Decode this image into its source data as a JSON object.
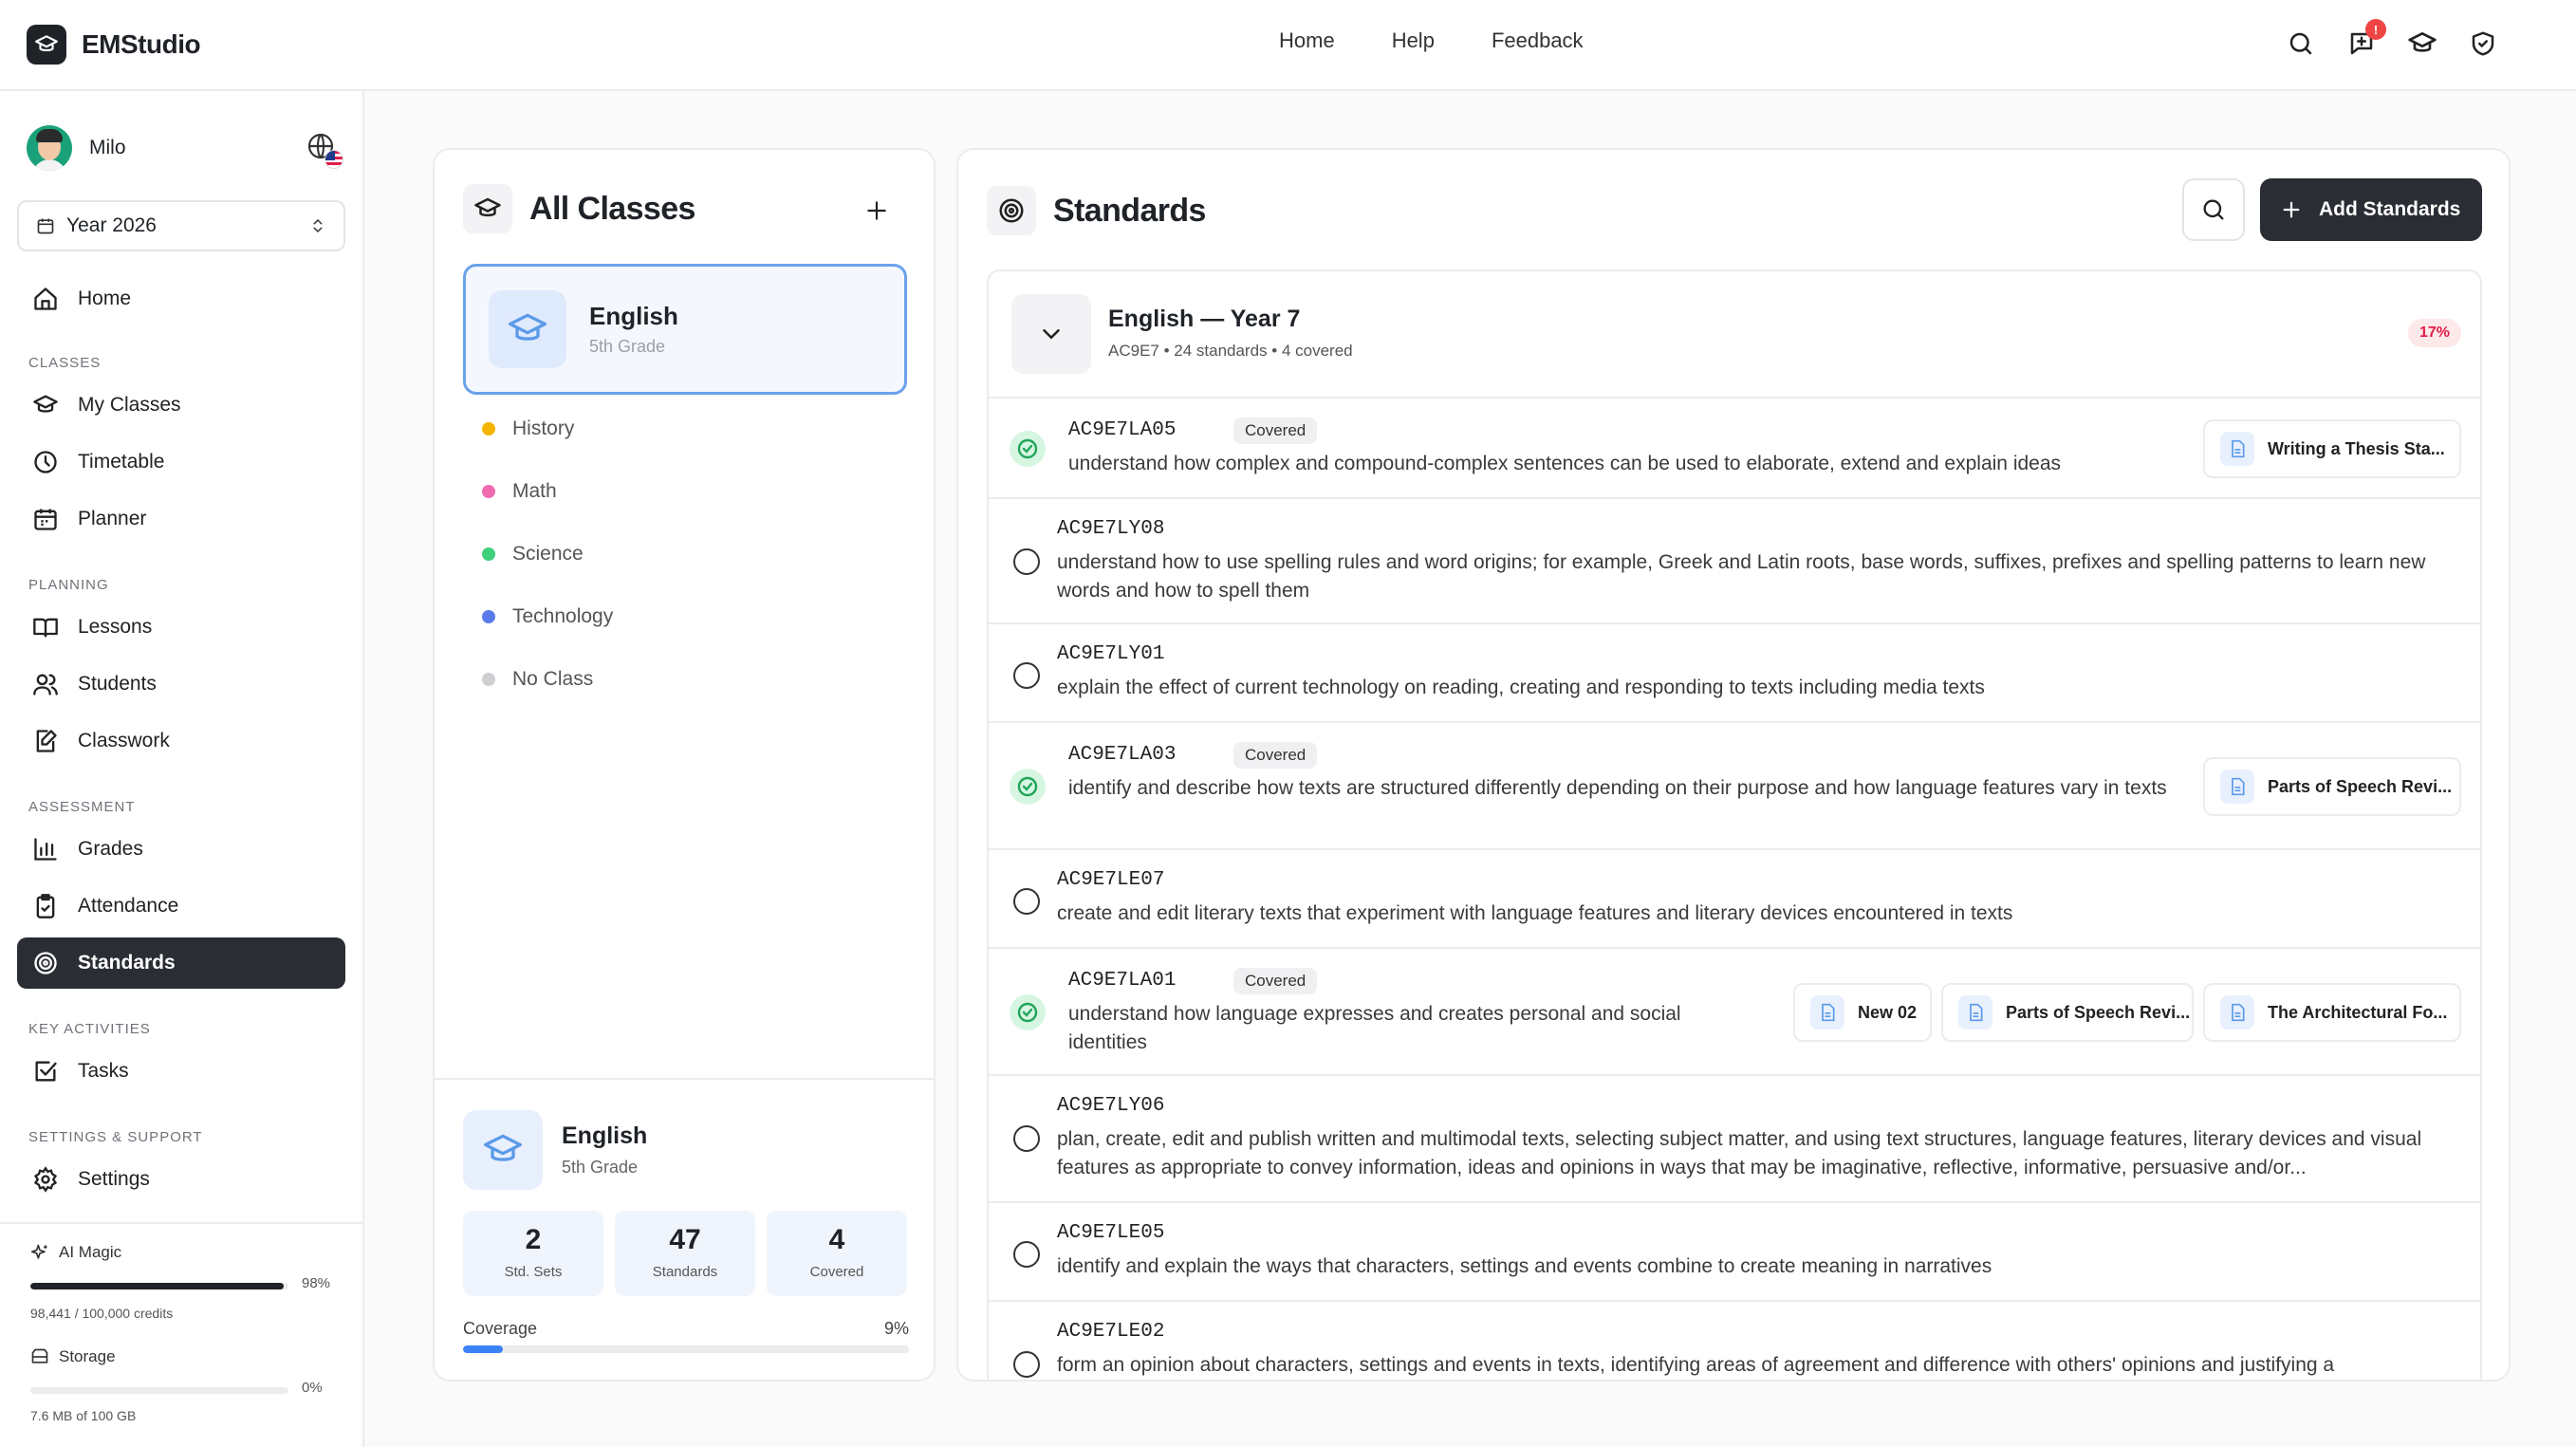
{
  "app": {
    "name": "EMStudio"
  },
  "topnav": {
    "items": [
      "Home",
      "Help",
      "Feedback"
    ],
    "notifications_count": "!"
  },
  "user": {
    "name": "Milo"
  },
  "year_select": {
    "value": "Year 2026"
  },
  "sidebar": {
    "home": "Home",
    "sections": {
      "classes": "CLASSES",
      "planning": "PLANNING",
      "assessment": "ASSESSMENT",
      "key_activities": "KEY ACTIVITIES",
      "settings_support": "SETTINGS & SUPPORT"
    },
    "items": {
      "my_classes": "My Classes",
      "timetable": "Timetable",
      "planner": "Planner",
      "lessons": "Lessons",
      "students": "Students",
      "classwork": "Classwork",
      "grades": "Grades",
      "attendance": "Attendance",
      "standards": "Standards",
      "tasks": "Tasks",
      "settings": "Settings"
    }
  },
  "usage": {
    "ai": {
      "label": "AI Magic",
      "percent_label": "98%",
      "fraction": 0.98,
      "detail": "98,441 / 100,000 credits"
    },
    "storage": {
      "label": "Storage",
      "percent_label": "0%",
      "fraction": 0.0,
      "detail": "7.6 MB of 100 GB"
    }
  },
  "classes_panel": {
    "title": "All Classes",
    "selected": {
      "name": "English",
      "grade": "5th Grade"
    },
    "classes": [
      {
        "name": "History",
        "color": "#f5b400"
      },
      {
        "name": "Math",
        "color": "#f06bb0"
      },
      {
        "name": "Science",
        "color": "#3ecf7a"
      },
      {
        "name": "Technology",
        "color": "#5b7bea"
      },
      {
        "name": "No Class",
        "color": "#cfcfd3"
      }
    ],
    "summary": {
      "name": "English",
      "grade": "5th Grade",
      "stats": [
        {
          "value": "2",
          "label": "Std. Sets"
        },
        {
          "value": "47",
          "label": "Standards"
        },
        {
          "value": "4",
          "label": "Covered"
        }
      ],
      "coverage_label": "Coverage",
      "coverage_value": "9%",
      "coverage_fraction": 0.09
    }
  },
  "standards_panel": {
    "title": "Standards",
    "add_button": "Add Standards",
    "group": {
      "title": "English — Year 7",
      "subtitle": "AC9E7 • 24 standards • 4 covered",
      "percent": "17%"
    },
    "covered_label": "Covered",
    "rows": [
      {
        "code": "AC9E7LA05",
        "covered": true,
        "text": "understand how complex and compound-complex sentences can be used to elaborate, extend and explain ideas",
        "lessons": [
          "Writing a Thesis Sta..."
        ]
      },
      {
        "code": "AC9E7LY08",
        "covered": false,
        "text": "understand how to use spelling rules and word origins; for example, Greek and Latin roots, base words, suffixes, prefixes and spelling patterns to learn new words and how to spell them",
        "lessons": []
      },
      {
        "code": "AC9E7LY01",
        "covered": false,
        "text": "explain the effect of current technology on reading, creating and responding to texts including media texts",
        "lessons": []
      },
      {
        "code": "AC9E7LA03",
        "covered": true,
        "text": "identify and describe how texts are structured differently depending on their purpose and how language features vary in texts",
        "lessons": [
          "Parts of Speech Revi..."
        ]
      },
      {
        "code": "AC9E7LE07",
        "covered": false,
        "text": "create and edit literary texts that experiment with language features and literary devices encountered in texts",
        "lessons": []
      },
      {
        "code": "AC9E7LA01",
        "covered": true,
        "text": "understand how language expresses and creates personal and social identities",
        "lessons": [
          "New 02",
          "Parts of Speech Revi...",
          "The Architectural Fo..."
        ]
      },
      {
        "code": "AC9E7LY06",
        "covered": false,
        "text": "plan, create, edit and publish written and multimodal texts, selecting subject matter, and using text structures, language features, literary devices and visual features as appropriate to convey information, ideas and opinions in ways that may be imaginative, reflective, informative, persuasive and/or...",
        "lessons": []
      },
      {
        "code": "AC9E7LE05",
        "covered": false,
        "text": "identify and explain the ways that characters, settings and events combine to create meaning in narratives",
        "lessons": []
      },
      {
        "code": "AC9E7LE02",
        "covered": false,
        "text": "form an opinion about characters, settings and events in texts, identifying areas of agreement and difference with others' opinions and justifying a",
        "lessons": []
      }
    ]
  }
}
